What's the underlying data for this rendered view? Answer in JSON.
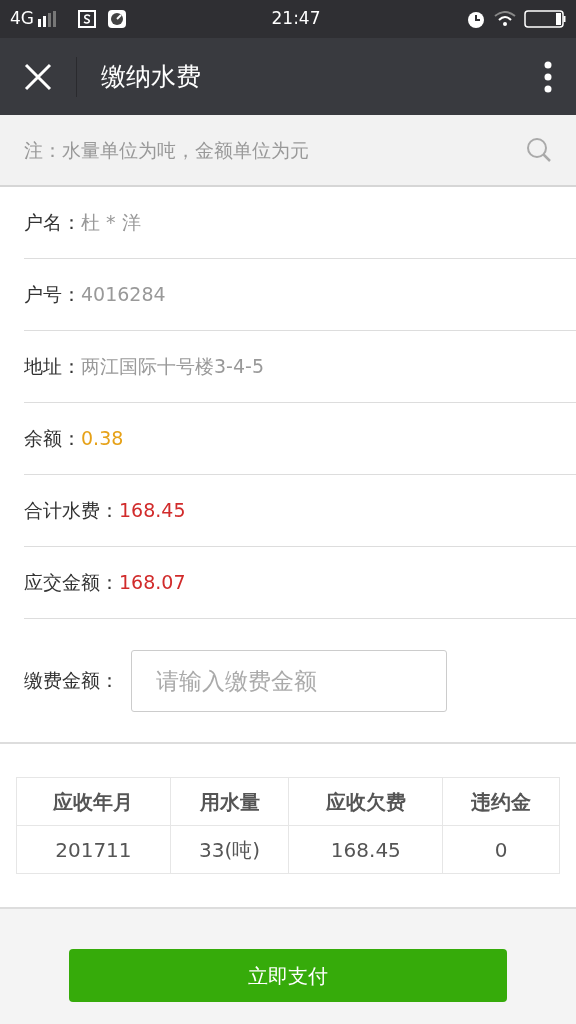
{
  "status_bar": {
    "network": "4G",
    "time": "21:47"
  },
  "nav": {
    "title": "缴纳水费"
  },
  "note": {
    "text": "注：水量单位为吨，金额单位为元"
  },
  "fields": [
    {
      "label": "户名：",
      "value": "杜 * 洋",
      "kind": "plain"
    },
    {
      "label": "户号：",
      "value": "4016284",
      "kind": "plain"
    },
    {
      "label": "地址：",
      "value": "两江国际十号楼3-4-5",
      "kind": "plain"
    },
    {
      "label": "余额：",
      "value": "0.38",
      "kind": "balance"
    },
    {
      "label": "合计水费：",
      "value": "168.45",
      "kind": "amount"
    },
    {
      "label": "应交金额：",
      "value": "168.07",
      "kind": "amount"
    }
  ],
  "payment": {
    "label": "缴费金额：",
    "placeholder": "请输入缴费金额"
  },
  "table": {
    "columns": [
      "应收年月",
      "用水量",
      "应收欠费",
      "违约金"
    ],
    "rows": [
      [
        "201711",
        "33(吨)",
        "168.45",
        "0"
      ]
    ]
  },
  "pay_button": "立即支付"
}
